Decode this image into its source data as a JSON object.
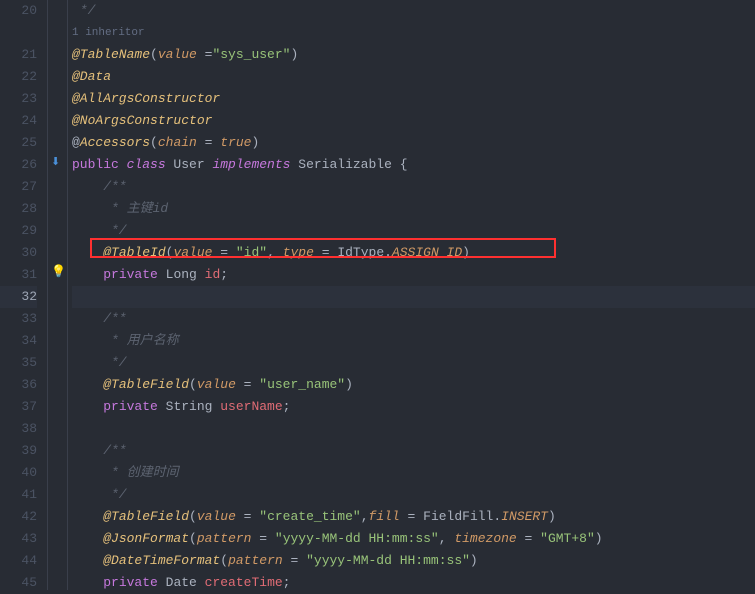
{
  "lines": {
    "20": {
      "num": "20"
    },
    "hint": {
      "text": "1 inheritor"
    },
    "21": {
      "num": "21"
    },
    "22": {
      "num": "22"
    },
    "23": {
      "num": "23"
    },
    "24": {
      "num": "24"
    },
    "25": {
      "num": "25"
    },
    "26": {
      "num": "26"
    },
    "27": {
      "num": "27"
    },
    "28": {
      "num": "28"
    },
    "29": {
      "num": "29"
    },
    "30": {
      "num": "30"
    },
    "31": {
      "num": "31"
    },
    "32": {
      "num": "32"
    },
    "33": {
      "num": "33"
    },
    "34": {
      "num": "34"
    },
    "35": {
      "num": "35"
    },
    "36": {
      "num": "36"
    },
    "37": {
      "num": "37"
    },
    "38": {
      "num": "38"
    },
    "39": {
      "num": "39"
    },
    "40": {
      "num": "40"
    },
    "41": {
      "num": "41"
    },
    "42": {
      "num": "42"
    },
    "43": {
      "num": "43"
    },
    "44": {
      "num": "44"
    },
    "45": {
      "num": "45"
    }
  },
  "code": {
    "l20": {
      "comment": " */"
    },
    "l21": {
      "anno": "@TableName",
      "p1": "(",
      "param": "value ",
      "eq": "=",
      "str": "\"sys_user\"",
      "p2": ")"
    },
    "l22": {
      "anno": "@Data"
    },
    "l23": {
      "anno": "@AllArgsConstructor"
    },
    "l24": {
      "anno": "@NoArgsConstructor"
    },
    "l25": {
      "at": "@",
      "anno": "Accessors",
      "p1": "(",
      "param": "chain ",
      "eq": "= ",
      "val": "true",
      "p2": ")"
    },
    "l26": {
      "pub": "public ",
      "cls": "class ",
      "name": "User ",
      "impl": "implements ",
      "iface": "Serializable ",
      "brace": "{"
    },
    "l27": {
      "comment": "    /**"
    },
    "l28": {
      "comment": "     * 主键id"
    },
    "l29": {
      "comment": "     */"
    },
    "l30": {
      "anno": "@TableId",
      "p1": "(",
      "param1": "value ",
      "eq1": "= ",
      "str1": "\"id\"",
      "comma": ", ",
      "param2": "type ",
      "eq2": "= ",
      "type": "IdType",
      "dot": ".",
      "enumv": "ASSIGN_ID",
      "p2": ")"
    },
    "l31": {
      "priv": "private ",
      "type": "Long ",
      "field": "id",
      "semi": ";"
    },
    "l33": {
      "comment": "    /**"
    },
    "l34": {
      "comment": "     * 用户名称"
    },
    "l35": {
      "comment": "     */"
    },
    "l36": {
      "anno": "@TableField",
      "p1": "(",
      "param": "value ",
      "eq": "= ",
      "str": "\"user_name\"",
      "p2": ")"
    },
    "l37": {
      "priv": "private ",
      "type": "String ",
      "field": "userName",
      "semi": ";"
    },
    "l39": {
      "comment": "    /**"
    },
    "l40": {
      "comment": "     * 创建时间"
    },
    "l41": {
      "comment": "     */"
    },
    "l42": {
      "anno": "@TableField",
      "p1": "(",
      "param1": "value ",
      "eq1": "= ",
      "str1": "\"create_time\"",
      "comma": ",",
      "param2": "fill ",
      "eq2": "= ",
      "type": "FieldFill",
      "dot": ".",
      "enumv": "INSERT",
      "p2": ")"
    },
    "l43": {
      "anno": "@JsonFormat",
      "p1": "(",
      "param1": "pattern ",
      "eq1": "= ",
      "str1": "\"yyyy-MM-dd HH:mm:ss\"",
      "comma": ", ",
      "param2": "timezone ",
      "eq2": "= ",
      "str2": "\"GMT+8\"",
      "p2": ")"
    },
    "l44": {
      "anno": "@DateTimeFormat",
      "p1": "(",
      "param": "pattern ",
      "eq": "= ",
      "str": "\"yyyy-MM-dd HH:mm:ss\"",
      "p2": ")"
    },
    "l45": {
      "priv": "private ",
      "type": "Date ",
      "field": "createTime",
      "semi": ";"
    }
  }
}
